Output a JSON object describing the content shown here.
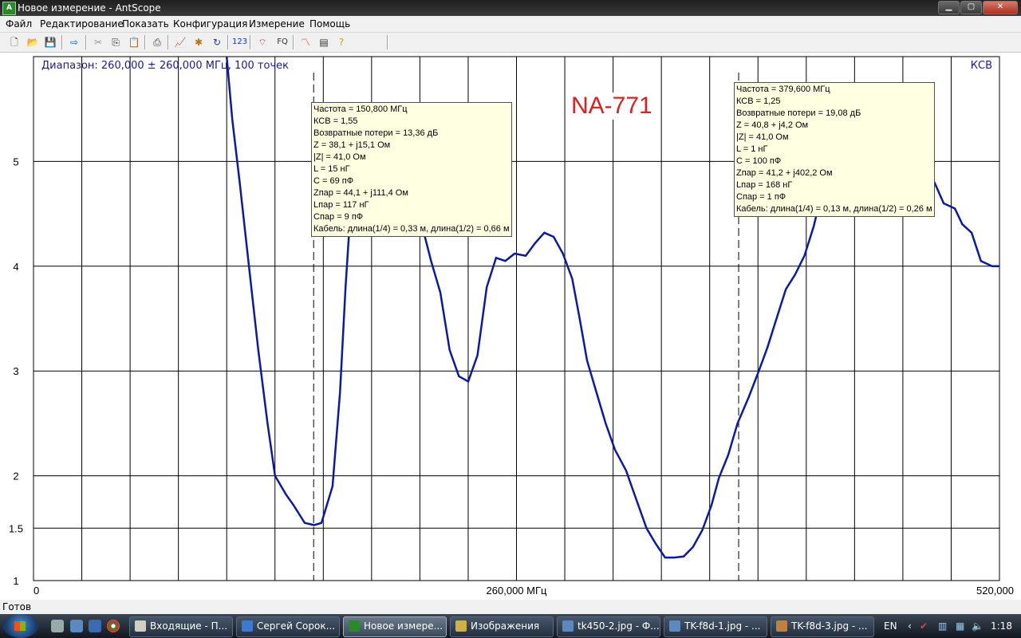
{
  "window": {
    "title": "Новое измерение - AntScope",
    "app_icon": "antscope-icon",
    "min": "▁",
    "max": "▢",
    "close": "✕"
  },
  "menu": [
    "Файл",
    "Редактирование",
    "Показать",
    "Конфигурация",
    "Измерение",
    "Помощь"
  ],
  "toolbar": {
    "fq_label": "FQ",
    "num_label": "123"
  },
  "chart": {
    "range_text": "Диапазон: 260,000 ± 260,000 МГц, 100 точек",
    "mode_label": "КСВ",
    "watermark": "NA-771",
    "x_center_label": "260,000 МГц",
    "line_color": "#0a1aa8"
  },
  "chart_data": {
    "type": "line",
    "title": "",
    "xlabel": "",
    "ylabel": "КСВ",
    "xlim": [
      0,
      520
    ],
    "ylim": [
      1,
      6
    ],
    "x_tick_labels": [
      "0",
      "260,000 МГц",
      "520,000"
    ],
    "y_tick_labels": [
      "1",
      "1.5",
      "2",
      "3",
      "4",
      "5"
    ],
    "y_ticks": [
      1,
      1.5,
      2,
      3,
      4,
      5
    ],
    "grid": true,
    "series": [
      {
        "x": [
          104,
          107,
          111,
          116,
          121,
          126,
          130,
          136,
          140,
          146,
          151,
          155,
          161,
          165,
          168,
          172,
          176,
          183,
          186,
          191,
          195,
          201,
          204,
          209,
          214,
          219,
          224,
          229,
          234,
          239,
          244,
          249,
          254,
          259,
          265,
          270,
          275,
          280,
          285,
          290,
          294,
          298,
          303,
          308,
          313,
          319,
          324,
          330,
          335,
          340,
          345,
          350,
          355,
          360,
          365,
          369,
          374,
          379,
          385,
          390,
          395,
          400,
          405,
          410,
          415,
          420,
          425,
          430,
          435,
          440,
          445,
          450,
          455,
          460,
          465,
          470,
          475,
          480,
          485,
          490,
          496,
          500,
          505,
          510,
          516,
          520
        ],
        "y": [
          6.0,
          5.4,
          4.8,
          4.0,
          3.2,
          2.5,
          2.0,
          1.82,
          1.72,
          1.55,
          1.53,
          1.55,
          1.9,
          2.8,
          3.8,
          4.9,
          5.5,
          5.55,
          5.45,
          5.3,
          5.1,
          4.9,
          4.7,
          4.4,
          4.05,
          3.75,
          3.2,
          2.95,
          2.9,
          3.15,
          3.8,
          4.08,
          4.05,
          4.12,
          4.1,
          4.22,
          4.32,
          4.28,
          4.12,
          3.88,
          3.5,
          3.1,
          2.8,
          2.5,
          2.25,
          2.05,
          1.8,
          1.5,
          1.35,
          1.22,
          1.22,
          1.23,
          1.32,
          1.48,
          1.72,
          1.98,
          2.2,
          2.5,
          2.75,
          2.98,
          3.22,
          3.5,
          3.78,
          3.92,
          4.1,
          4.38,
          4.75,
          5.0,
          5.08,
          4.92,
          4.75,
          4.55,
          4.53,
          4.5,
          4.6,
          4.72,
          4.82,
          4.86,
          4.8,
          4.6,
          4.55,
          4.4,
          4.32,
          4.05,
          4.0,
          4.0
        ]
      }
    ],
    "markers": [
      {
        "x": 150.8
      },
      {
        "x": 379.6
      }
    ]
  },
  "marker1": {
    "lines": [
      "Частота = 150,800 МГц",
      "КСВ = 1,55",
      "Возвратные потери = 13,36 дБ",
      "Z = 38,1 + j15,1 Ом",
      "|Z| = 41,0 Ом",
      "L = 15 нГ",
      "C = 69 пФ",
      "Zпар = 44,1 + j111,4 Ом",
      "Lпар = 117 нГ",
      "Cпар = 9 пФ",
      "Кабель: длина(1/4) = 0,33 м, длина(1/2) = 0,66 м"
    ]
  },
  "marker2": {
    "lines": [
      "Частота = 379,600 МГц",
      "КСВ = 1,25",
      "Возвратные потери = 19,08 дБ",
      "Z = 40,8 + j4,2 Ом",
      "|Z| = 41,0 Ом",
      "L = 1 нГ",
      "C = 100 пФ",
      "Zпар = 41,2 + j402,2 Ом",
      "Lпар = 168 нГ",
      "Cпар = 1 пФ",
      "Кабель: длина(1/4) = 0,13 м, длина(1/2) = 0,26 м"
    ]
  },
  "status": {
    "text": "Готов"
  },
  "taskbar": {
    "tasks": [
      "Входящие - П...",
      "Сергей Сорок...",
      "Новое измере...",
      "Изображения",
      "tk450-2.jpg - Ф...",
      "TK-f8d-1.jpg - ...",
      "TK-f8d-3.jpg - ..."
    ],
    "lang": "EN",
    "clock": "1:18"
  }
}
